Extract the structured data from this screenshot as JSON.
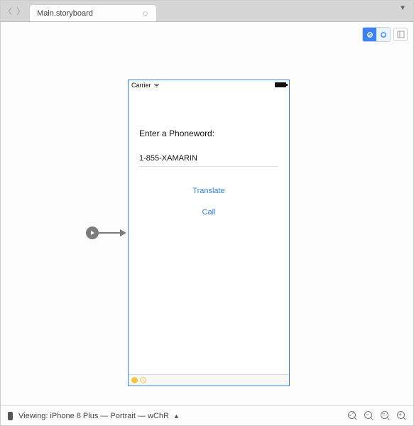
{
  "tabbar": {
    "tab_title": "Main.storyboard",
    "close_glyph": "○"
  },
  "statusbar": {
    "carrier": "Carrier",
    "wifi_glyph": "ᯤ"
  },
  "form": {
    "label": "Enter a Phoneword:",
    "textfield_value": "1-855-XAMARIN",
    "translate_label": "Translate",
    "call_label": "Call"
  },
  "footer": {
    "viewing_prefix": "Viewing: ",
    "device": "iPhone 8 Plus",
    "orientation": "Portrait",
    "size_class": "wChR",
    "full_text": "Viewing: iPhone 8 Plus — Portrait — wChR"
  }
}
